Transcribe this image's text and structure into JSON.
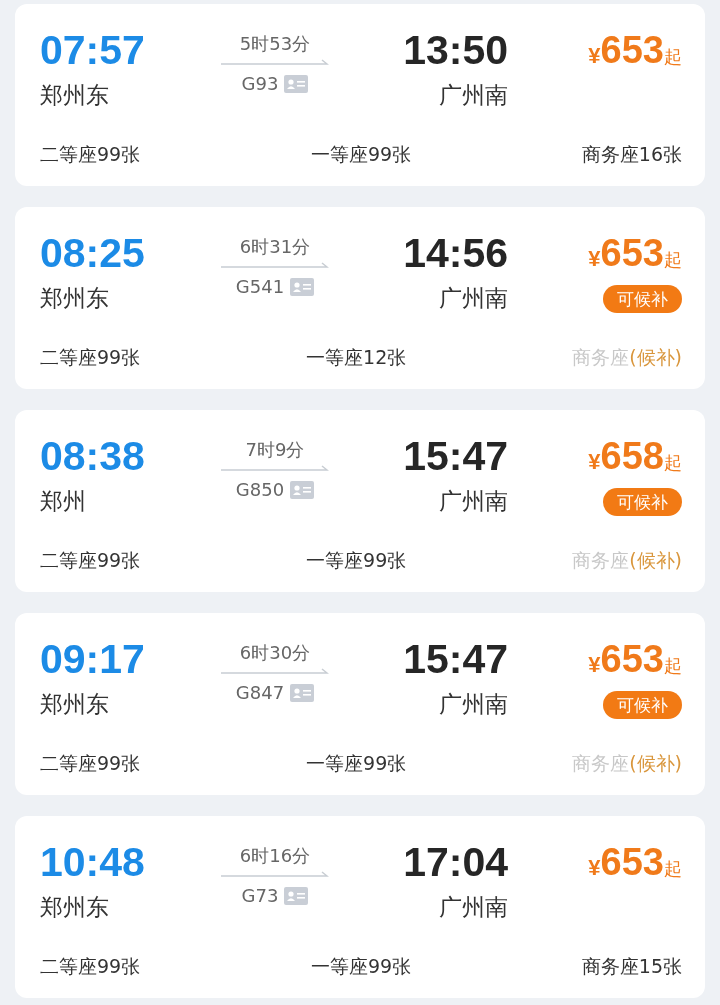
{
  "trains": [
    {
      "depart_time": "07:57",
      "depart_station": "郑州东",
      "duration": "5时53分",
      "train_no": "G93",
      "arrive_time": "13:50",
      "arrive_station": "广州南",
      "currency": "¥",
      "price": "653",
      "price_suffix": "起",
      "seats": [
        {
          "kind": "available",
          "label": "二等座99张"
        },
        {
          "kind": "available",
          "label": "一等座99张"
        },
        {
          "kind": "available",
          "label": "商务座16张"
        }
      ]
    },
    {
      "depart_time": "08:25",
      "depart_station": "郑州东",
      "duration": "6时31分",
      "train_no": "G541",
      "arrive_time": "14:56",
      "arrive_station": "广州南",
      "currency": "¥",
      "price": "653",
      "price_suffix": "起",
      "badge": "可候补",
      "seats": [
        {
          "kind": "available",
          "label": "二等座99张"
        },
        {
          "kind": "available",
          "label": "一等座12张"
        },
        {
          "kind": "waitlist",
          "label": "商务座",
          "status": "(候补)"
        }
      ]
    },
    {
      "depart_time": "08:38",
      "depart_station": "郑州",
      "duration": "7时9分",
      "train_no": "G850",
      "arrive_time": "15:47",
      "arrive_station": "广州南",
      "currency": "¥",
      "price": "658",
      "price_suffix": "起",
      "badge": "可候补",
      "seats": [
        {
          "kind": "available",
          "label": "二等座99张"
        },
        {
          "kind": "available",
          "label": "一等座99张"
        },
        {
          "kind": "waitlist",
          "label": "商务座",
          "status": "(候补)"
        }
      ]
    },
    {
      "depart_time": "09:17",
      "depart_station": "郑州东",
      "duration": "6时30分",
      "train_no": "G847",
      "arrive_time": "15:47",
      "arrive_station": "广州南",
      "currency": "¥",
      "price": "653",
      "price_suffix": "起",
      "badge": "可候补",
      "seats": [
        {
          "kind": "available",
          "label": "二等座99张"
        },
        {
          "kind": "available",
          "label": "一等座99张"
        },
        {
          "kind": "waitlist",
          "label": "商务座",
          "status": "(候补)"
        }
      ]
    },
    {
      "depart_time": "10:48",
      "depart_station": "郑州东",
      "duration": "6时16分",
      "train_no": "G73",
      "arrive_time": "17:04",
      "arrive_station": "广州南",
      "currency": "¥",
      "price": "653",
      "price_suffix": "起",
      "seats": [
        {
          "kind": "available",
          "label": "二等座99张"
        },
        {
          "kind": "available",
          "label": "一等座99张"
        },
        {
          "kind": "available",
          "label": "商务座15张"
        }
      ]
    }
  ]
}
